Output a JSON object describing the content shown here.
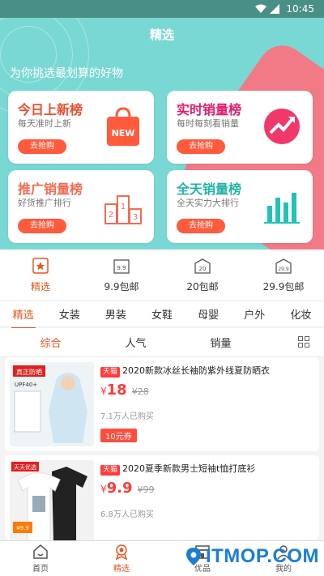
{
  "status_bar": {
    "time": "10:45"
  },
  "hero": {
    "title": "精选",
    "subtitle": "为你挑选最划算的好物",
    "cards": [
      {
        "title": "今日上新榜",
        "desc": "每天准时上新",
        "button": "去抢购",
        "color": "#f04b2c",
        "icon": "shopping-bag-new-icon"
      },
      {
        "title": "实时销量榜",
        "desc": "每时每刻看销量",
        "button": "去抢购",
        "color": "#e8196d",
        "icon": "trend-chart-icon"
      },
      {
        "title": "推广销量榜",
        "desc": "好货推广排行",
        "button": "去抢购",
        "color": "#f46a53",
        "icon": "podium-icon"
      },
      {
        "title": "全天销量榜",
        "desc": "全天实力大排行",
        "button": "去抢购",
        "color": "#22b3a8",
        "icon": "bar-chart-icon"
      }
    ],
    "icon_text": {
      "new": "NEW",
      "podium": [
        "2",
        "1",
        "3"
      ]
    }
  },
  "categories": [
    {
      "label": "精选",
      "active": true,
      "icon": "star-bookmark-icon"
    },
    {
      "label": "9.9包邮",
      "active": false,
      "icon": "package-9.9-icon"
    },
    {
      "label": "20包邮",
      "active": false,
      "icon": "package-20-icon"
    },
    {
      "label": "29.9包邮",
      "active": false,
      "icon": "package-29.9-icon"
    }
  ],
  "category_icon_text": [
    "9.9",
    "20",
    "29.9"
  ],
  "tabs": [
    "精选",
    "女装",
    "男装",
    "女鞋",
    "母婴",
    "户外",
    "化妆"
  ],
  "sort": {
    "items": [
      "综合",
      "人气",
      "销量"
    ],
    "active": "综合"
  },
  "products": [
    {
      "badge": "天猫",
      "title": "2020新款冰丝长袖防紫外线夏防晒衣",
      "price_symbol": "¥",
      "price": "18",
      "old_price": "¥28",
      "sales": "7.1万人已购买",
      "coupon": "10元券",
      "image_labels": [
        "真正防晒",
        "UPF40+"
      ]
    },
    {
      "badge": "天猫",
      "title": "2020夏季新款男士短袖t恤打底衫",
      "price_symbol": "¥",
      "price": "9.9",
      "old_price": "¥99",
      "sales": "6.8万人已购买",
      "image_labels": [
        "天天优选",
        "¥9.9"
      ]
    }
  ],
  "bottom_nav": [
    {
      "label": "首页",
      "active": false,
      "icon": "home-icon"
    },
    {
      "label": "精选",
      "active": true,
      "icon": "medal-icon"
    },
    {
      "label": "优品",
      "active": false,
      "icon": "store-icon"
    },
    {
      "label": "我的",
      "active": false,
      "icon": "user-icon"
    }
  ],
  "watermark": "ITMOP.COM",
  "colors": {
    "accent": "#e8551f",
    "hero_bg": "#7ad8d4",
    "price": "#ff3b3b",
    "button": "#ff5a3c"
  }
}
